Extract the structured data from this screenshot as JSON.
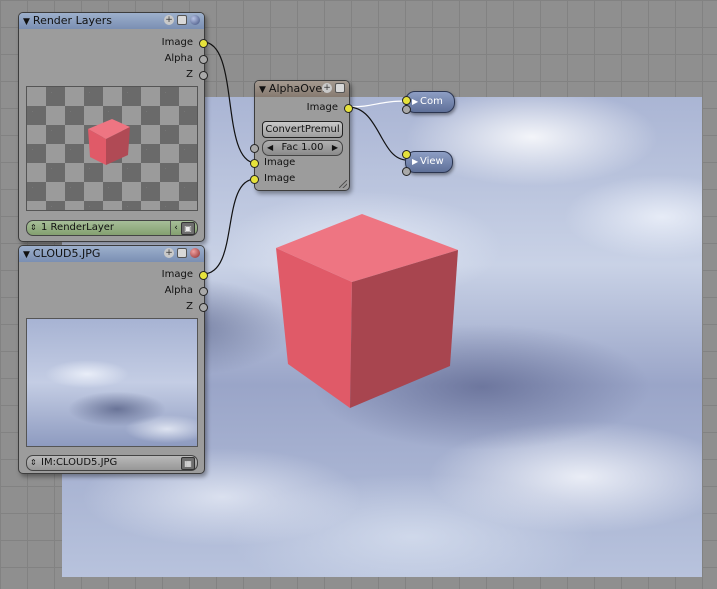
{
  "nodes": {
    "render_layers": {
      "title": "Render Layers",
      "outputs": [
        "Image",
        "Alpha",
        "Z"
      ],
      "layer_select": "1 RenderLayer"
    },
    "cloud_image": {
      "title": "CLOUD5.JPG",
      "outputs": [
        "Image",
        "Alpha",
        "Z"
      ],
      "image_select": "IM:CLOUD5.JPG"
    },
    "alpha_over": {
      "title": "AlphaOver",
      "output": "Image",
      "convert_button": "ConvertPremul",
      "fac_field": "Fac 1.00",
      "inputs": [
        "Image",
        "Image"
      ]
    },
    "composite": {
      "label": "Com"
    },
    "viewer": {
      "label": "View"
    }
  },
  "colors": {
    "cube": "#e05a68",
    "socket_yellow": "#e6e23c",
    "socket_grey": "#a9a9a9",
    "node_body": "#9c9c9c",
    "grid_bg": "#8f8f8f"
  },
  "icons": {
    "collapse": "triangle-down-icon",
    "add": "plus-icon",
    "menu": "menu-icon",
    "preview_sphere": "sphere-icon",
    "composite_arrow": "play-icon",
    "view_arrow": "play-icon"
  }
}
